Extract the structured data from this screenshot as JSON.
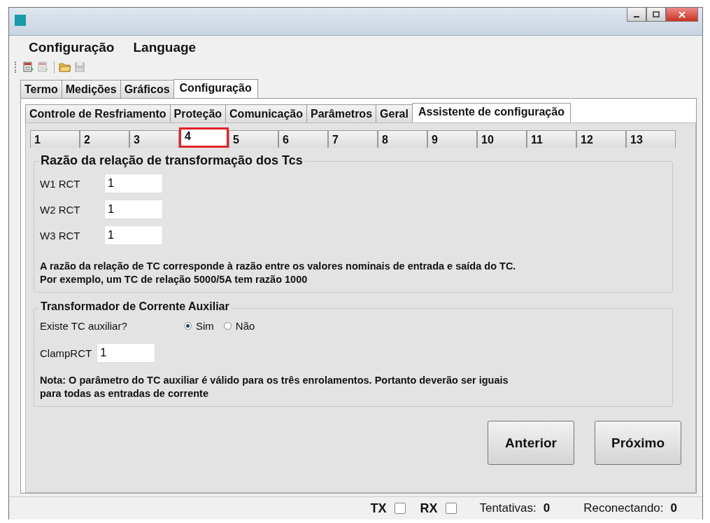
{
  "menu": [
    "Configuração",
    "Language"
  ],
  "toolbar": [
    {
      "kind": "device-add"
    },
    {
      "kind": "device-sub",
      "disabled": true
    },
    {
      "kind": "separator"
    },
    {
      "kind": "folder"
    },
    {
      "kind": "save",
      "disabled": true
    }
  ],
  "tabs": [
    {
      "label": "Termo",
      "selected": false
    },
    {
      "label": "Medições",
      "selected": false
    },
    {
      "label": "Gráficos",
      "selected": false
    },
    {
      "label": "Configuração",
      "selected": true
    }
  ],
  "subtabs": [
    {
      "label": "Controle de Resfriamento",
      "selected": false
    },
    {
      "label": "Proteção",
      "selected": false
    },
    {
      "label": "Comunicação",
      "selected": false
    },
    {
      "label": "Parâmetros",
      "selected": false
    },
    {
      "label": "Geral",
      "selected": false
    },
    {
      "label": "Assistente de configuração",
      "selected": true
    }
  ],
  "steps": [
    {
      "label": "1",
      "selected": false
    },
    {
      "label": "2",
      "selected": false
    },
    {
      "label": "3",
      "selected": false
    },
    {
      "label": "4",
      "selected": true
    },
    {
      "label": "5",
      "selected": false
    },
    {
      "label": "6",
      "selected": false
    },
    {
      "label": "7",
      "selected": false
    },
    {
      "label": "8",
      "selected": false
    },
    {
      "label": "9",
      "selected": false
    },
    {
      "label": "10",
      "selected": false
    },
    {
      "label": "11",
      "selected": false
    },
    {
      "label": "12",
      "selected": false
    },
    {
      "label": "13",
      "selected": false
    }
  ],
  "ratio_group": {
    "title": "Razão da relação de transformação dos Tcs",
    "fields": [
      {
        "label": "W1 RCT",
        "value": "1"
      },
      {
        "label": "W2 RCT",
        "value": "1"
      },
      {
        "label": "W3 RCT",
        "value": "1"
      }
    ],
    "note": [
      "A razão da relação de TC corresponde à razão entre os valores nominais de entrada e saída do TC.",
      "Por exemplo, um TC de relação 5000/5A tem razão 1000"
    ]
  },
  "aux_group": {
    "title": "Transformador de Corrente Auxiliar",
    "question": "Existe TC auxiliar?",
    "options": [
      {
        "label": "Sim",
        "selected": true
      },
      {
        "label": "Não",
        "selected": false
      }
    ],
    "field": {
      "label": "ClampRCT",
      "value": "1"
    },
    "note": [
      "Nota: O parâmetro do TC auxiliar é válido para os três enrolamentos. Portanto deverão ser iguais",
      "para todas as entradas de corrente"
    ]
  },
  "buttons": [
    "Anterior",
    "Próximo"
  ],
  "status_bar": {
    "tx": {
      "label": "TX",
      "checked": false
    },
    "rx": {
      "label": "RX",
      "checked": false
    },
    "attempts": {
      "label": "Tentativas:",
      "value": "0"
    },
    "reconnecting": {
      "label": "Reconectando:",
      "value": "0"
    }
  }
}
